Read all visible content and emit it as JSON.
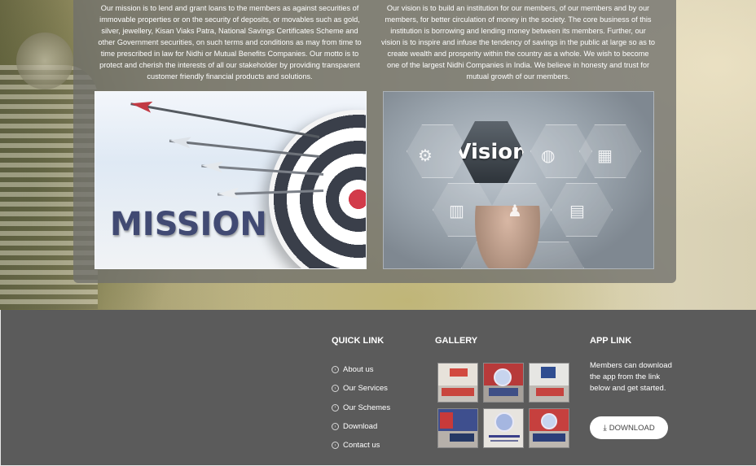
{
  "mission": {
    "text": "Our mission is to lend and grant loans to the members as against securities of immovable properties or on the security of deposits, or movables such as gold, silver, jewellery, Kisan Viaks Patra, National Savings Certificates Scheme and other Government securities, on such terms and conditions as may from time to time prescribed in law for Nidhi or Mutual Benefits Companies. Our motto is to protect and cherish the interests of all our stakeholder by providing transparent customer friendly financial products and solutions.",
    "image_label": "MISSION"
  },
  "vision": {
    "text": "Our vision is to build an institution for our members, of our members and by our members, for better circulation of money in the society. The core business of this institution is borrowing and lending money between its members. Further, our vision is to inspire and infuse the tendency of savings in the public at large so as to create wealth and prosperity within the country as a whole. We wish to become one of the largest Nidhi Companies in India. We believe in honesty and trust for mutual growth of our members.",
    "image_label": "Vision"
  },
  "footer": {
    "quick_link": {
      "title": "QUICK LINK",
      "items": [
        {
          "label": "About us",
          "icon": "circle-chevron-right-icon"
        },
        {
          "label": "Our Services",
          "icon": "circle-chevron-right-icon"
        },
        {
          "label": "Our Schemes",
          "icon": "circle-chevron-right-icon"
        },
        {
          "label": "Download",
          "icon": "circle-chevron-right-icon"
        },
        {
          "label": "Contact us",
          "icon": "circle-chevron-right-icon"
        }
      ]
    },
    "gallery": {
      "title": "GALLERY",
      "photo_count": 6
    },
    "app_link": {
      "title": "APP LINK",
      "text": "Members can download the app from the link below and get started.",
      "button_label": "DOWNLOAD",
      "button_icon": "download-icon"
    }
  },
  "colors": {
    "footer_bg": "#5b5b5b",
    "panel_bg": "#70706c",
    "mission_text": "#414a73",
    "accent_red": "#d23b4a"
  }
}
